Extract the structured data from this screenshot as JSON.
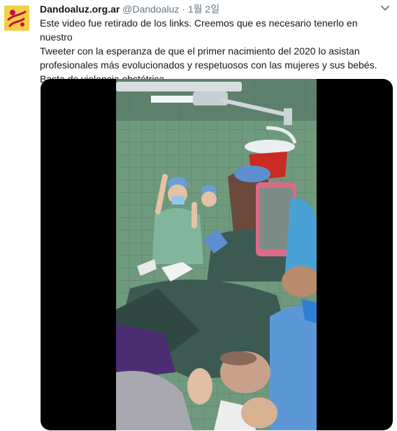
{
  "author": {
    "display_name": "Dandoaluz.org.ar",
    "handle": "@Dandoaluz",
    "separator": "·",
    "date": "1월 2일"
  },
  "tweet": {
    "lines": [
      "Este video fue retirado de los links. Creemos que es necesario tenerlo en nuestro",
      "Tweeter con la esperanza de que el primer nacimiento del 2020 lo asistan",
      "profesionales  más evolucionados y respetuosos con las mujeres y sus bebés.",
      "Basta de violencia obstétrica"
    ]
  },
  "icons": {
    "avatar": "dandoaluz-logo-icon",
    "menu": "chevron-down-icon"
  },
  "colors": {
    "avatar_bg": "#f2cf44",
    "logo_accent": "#c8103e",
    "scrubs_green": "#82b69c",
    "gown_dark": "#3d5a52",
    "wall_tile": "#6f9a7e",
    "media_bg": "#000000"
  }
}
